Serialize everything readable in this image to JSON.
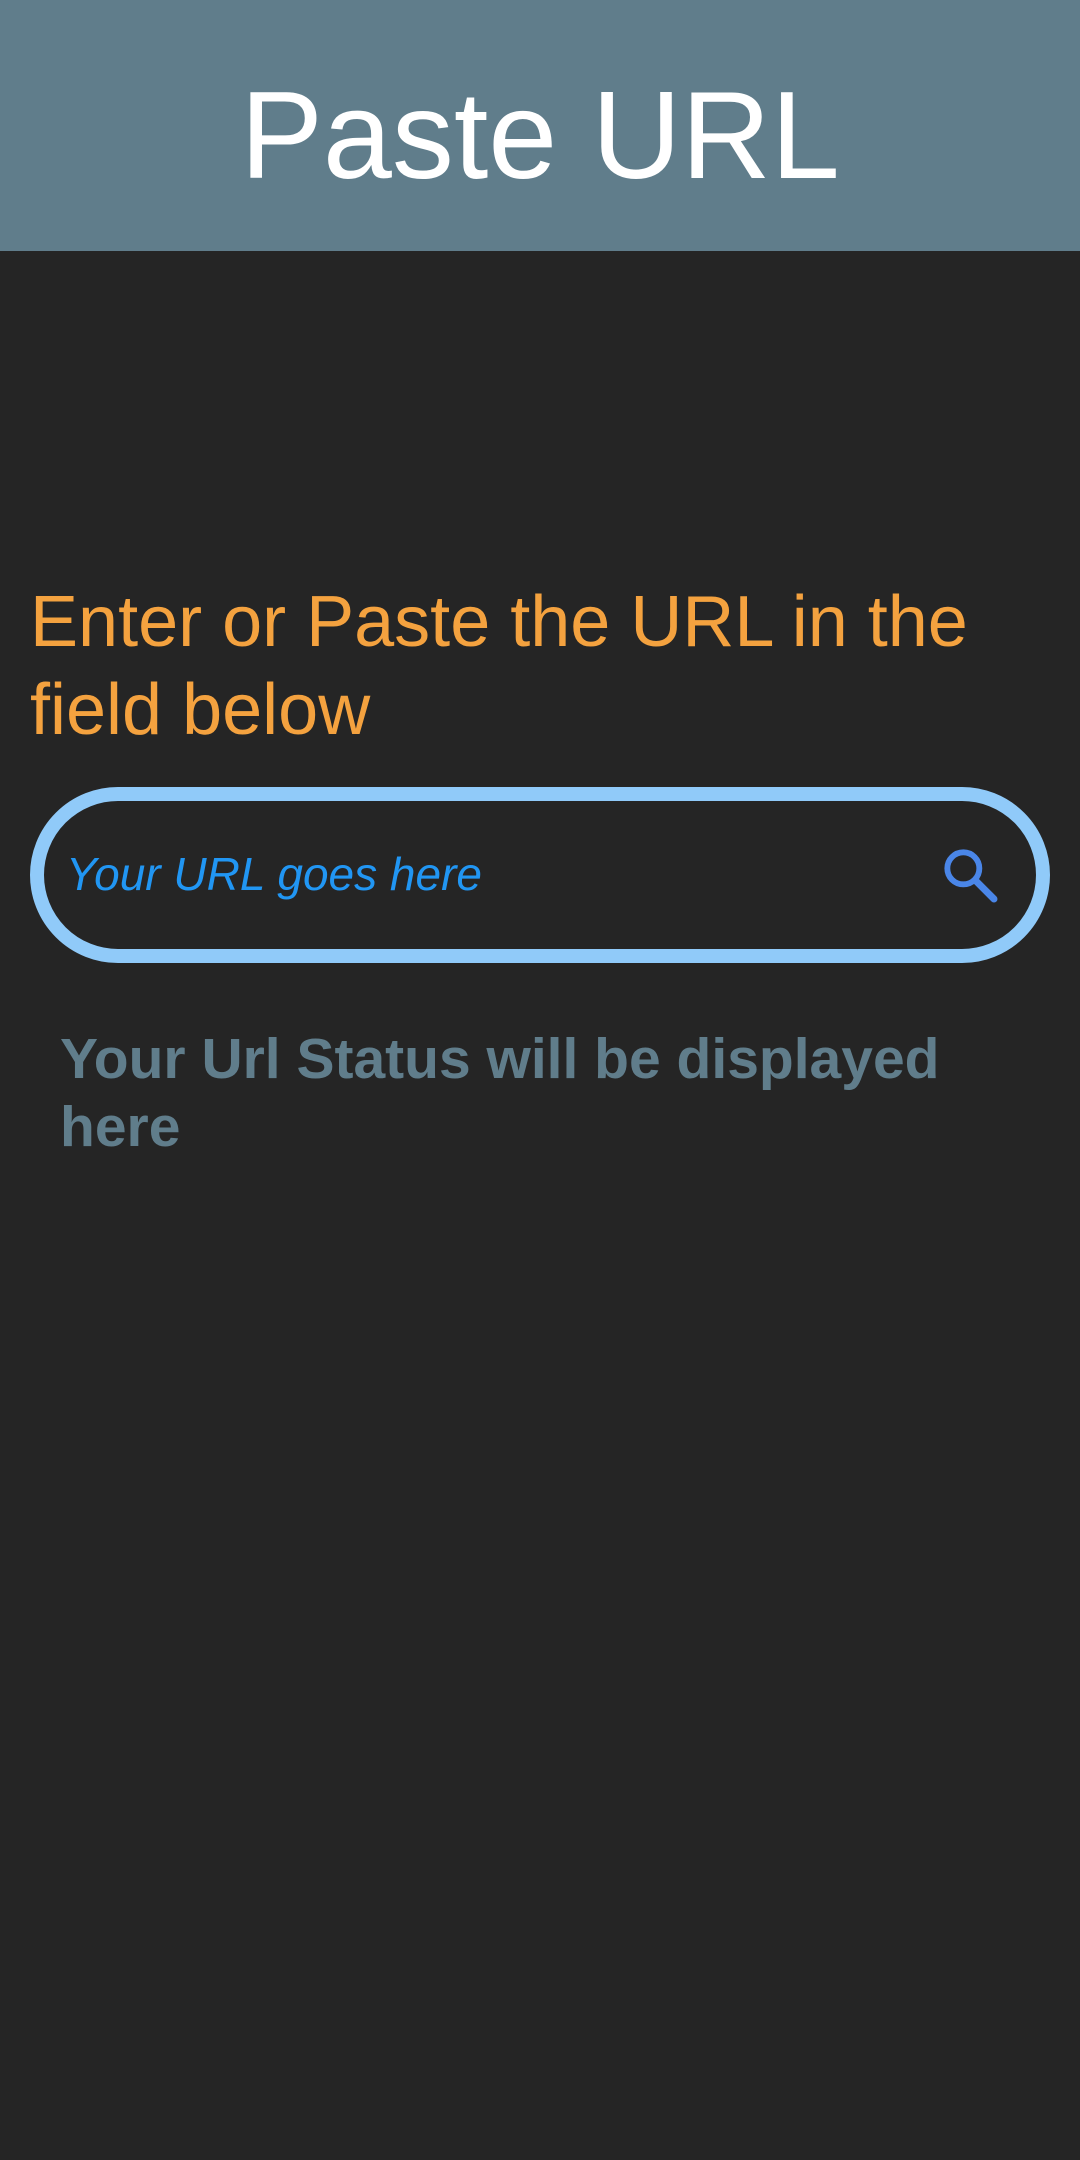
{
  "app_bar": {
    "title": "Paste URL",
    "background_color": "#607d8b"
  },
  "main": {
    "instruction": "Enter or Paste the URL in the field below",
    "url_field": {
      "value": "",
      "placeholder": "Your URL goes here",
      "border_color": "#90caf9",
      "icon": "search-icon"
    },
    "status": "Your Url Status will be displayed here"
  },
  "colors": {
    "background": "#252525",
    "accent_orange": "#f4a23f",
    "accent_blue": "#2196f3",
    "status_gray": "#607d8b"
  }
}
